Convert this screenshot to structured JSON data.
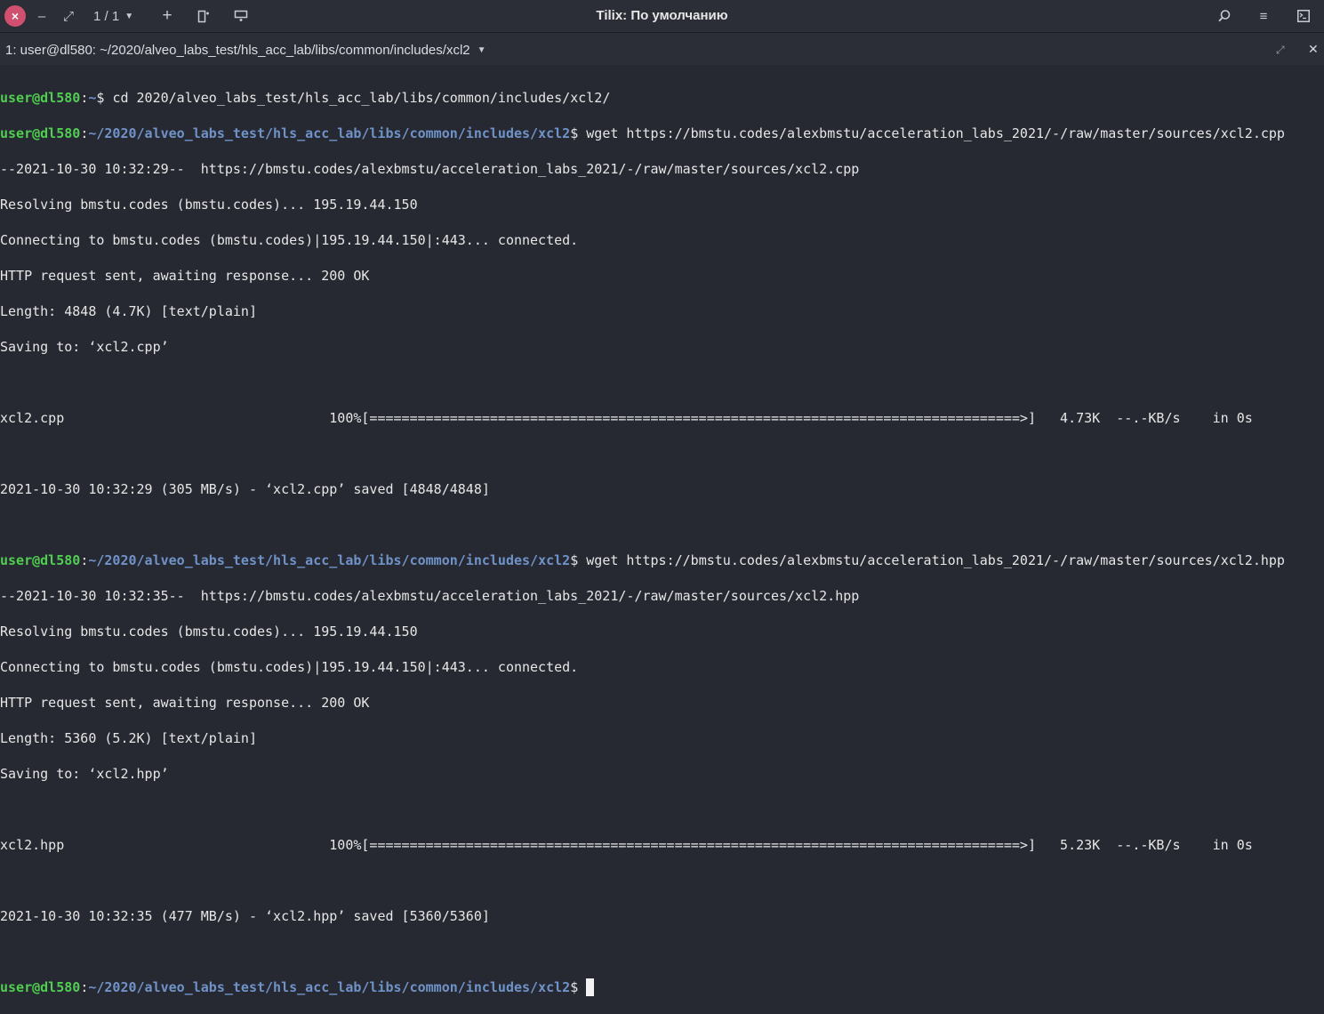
{
  "header": {
    "title": "Tilix: По умолчанию",
    "close_icon": "×",
    "minimize_icon": "–",
    "restore_icon": "⤢",
    "counter": "1 / 1",
    "add_icon": "+",
    "search_icon": "⌕",
    "menu_icon": "≡",
    "terminal_icon": "▣"
  },
  "session": {
    "title": "1: user@dl580: ~/2020/alveo_labs_test/hls_acc_lab/libs/common/includes/xcl2",
    "maximize_icon": "⤢",
    "close_icon": "✕"
  },
  "prompt": {
    "user": "user@dl580",
    "cwd_home": "~",
    "cwd": "~/2020/alveo_labs_test/hls_acc_lab/libs/common/includes/xcl2"
  },
  "lines": {
    "cmd1": "cd 2020/alveo_labs_test/hls_acc_lab/libs/common/includes/xcl2/",
    "cmd2": "wget https://bmstu.codes/alexbmstu/acceleration_labs_2021/-/raw/master/sources/xcl2.cpp",
    "o1": "--2021-10-30 10:32:29--  https://bmstu.codes/alexbmstu/acceleration_labs_2021/-/raw/master/sources/xcl2.cpp",
    "o2": "Resolving bmstu.codes (bmstu.codes)... 195.19.44.150",
    "o3": "Connecting to bmstu.codes (bmstu.codes)|195.19.44.150|:443... connected.",
    "o4": "HTTP request sent, awaiting response... 200 OK",
    "o5": "Length: 4848 (4.7K) [text/plain]",
    "o6": "Saving to: ‘xcl2.cpp’",
    "o7": "xcl2.cpp                                 100%[=================================================================================>]   4.73K  --.-KB/s    in 0s",
    "o8": "2021-10-30 10:32:29 (305 MB/s) - ‘xcl2.cpp’ saved [4848/4848]",
    "cmd3": "wget https://bmstu.codes/alexbmstu/acceleration_labs_2021/-/raw/master/sources/xcl2.hpp",
    "p1": "--2021-10-30 10:32:35--  https://bmstu.codes/alexbmstu/acceleration_labs_2021/-/raw/master/sources/xcl2.hpp",
    "p2": "Resolving bmstu.codes (bmstu.codes)... 195.19.44.150",
    "p3": "Connecting to bmstu.codes (bmstu.codes)|195.19.44.150|:443... connected.",
    "p4": "HTTP request sent, awaiting response... 200 OK",
    "p5": "Length: 5360 (5.2K) [text/plain]",
    "p6": "Saving to: ‘xcl2.hpp’",
    "p7": "xcl2.hpp                                 100%[=================================================================================>]   5.23K  --.-KB/s    in 0s",
    "p8": "2021-10-30 10:32:35 (477 MB/s) - ‘xcl2.hpp’ saved [5360/5360]"
  },
  "colors": {
    "background": "#272932",
    "prompt_user": "#4fcf4f",
    "prompt_path": "#6f93c8",
    "close_button": "#d1506f"
  }
}
